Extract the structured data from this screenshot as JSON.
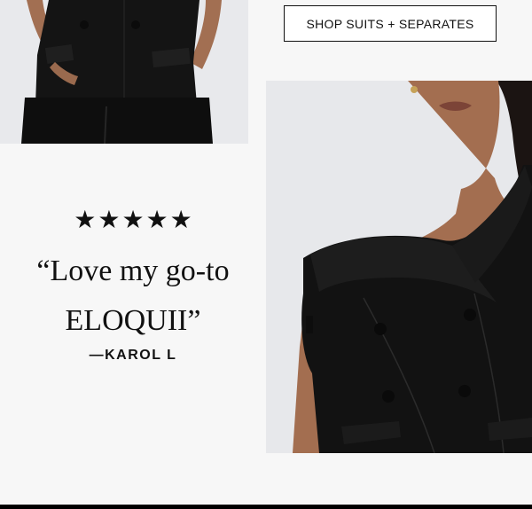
{
  "cta": {
    "label": "SHOP SUITS + SEPARATES"
  },
  "review": {
    "stars": [
      "★",
      "★",
      "★",
      "★",
      "★"
    ],
    "quote": "“Love my go-to ELOQUII”",
    "author": "—KAROL L"
  },
  "images": {
    "left": {
      "subject": "black-vest-top-and-trousers"
    },
    "right": {
      "subject": "off-shoulder-black-blazer"
    }
  },
  "colors": {
    "text": "#111111",
    "background": "#f7f7f7",
    "bar": "#000000"
  }
}
